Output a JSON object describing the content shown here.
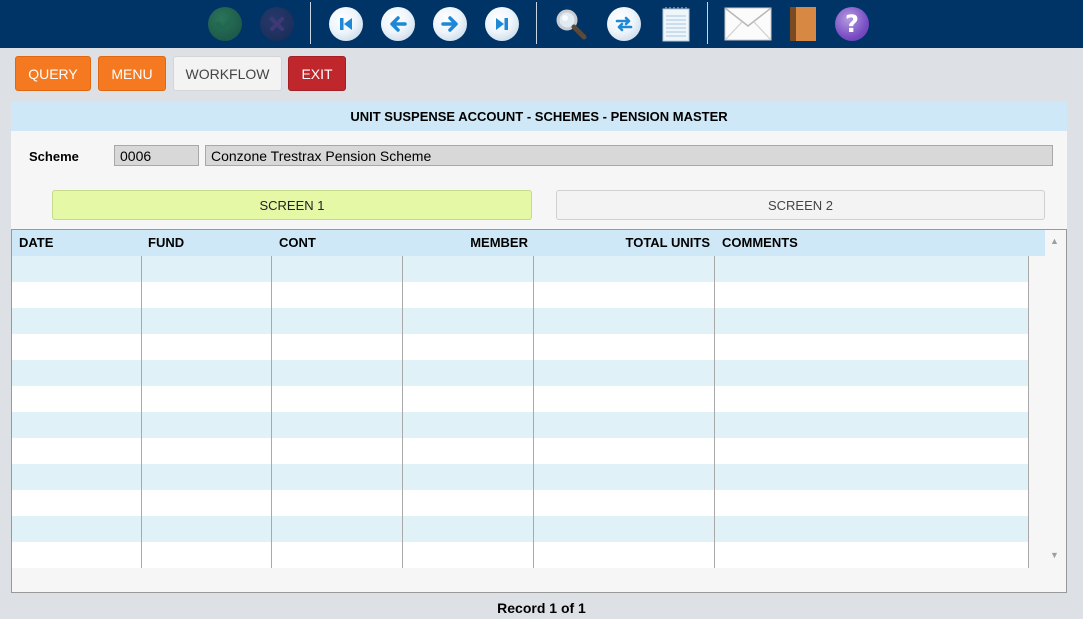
{
  "toolbar": {
    "icons": [
      "confirm-check-icon",
      "cancel-x-icon",
      "first-record-icon",
      "previous-record-icon",
      "next-record-icon",
      "last-record-icon",
      "search-icon",
      "refresh-icon",
      "notepad-icon",
      "mail-icon",
      "book-icon",
      "help-icon"
    ],
    "help_glyph": "?"
  },
  "actions": {
    "query": "QUERY",
    "menu": "MENU",
    "workflow": "WORKFLOW",
    "exit": "EXIT"
  },
  "form": {
    "title": "UNIT SUSPENSE ACCOUNT - SCHEMES - PENSION MASTER",
    "scheme_label": "Scheme",
    "scheme_code": "0006",
    "scheme_name": "Conzone Trestrax Pension Scheme",
    "screen1_label": "SCREEN 1",
    "screen2_label": "SCREEN 2"
  },
  "grid": {
    "columns": [
      "DATE",
      "FUND",
      "CONT",
      "MEMBER",
      "TOTAL UNITS",
      "COMMENTS"
    ],
    "row_count": 12
  },
  "footer": {
    "record_status": "Record 1 of 1"
  },
  "colors": {
    "toolbar_bg": "#003366",
    "accent_orange": "#f47920",
    "exit_red": "#c0272d",
    "header_blue": "#cfe8f7",
    "active_screen": "#e5f8a5",
    "row_alt": "#e1f1f8"
  }
}
